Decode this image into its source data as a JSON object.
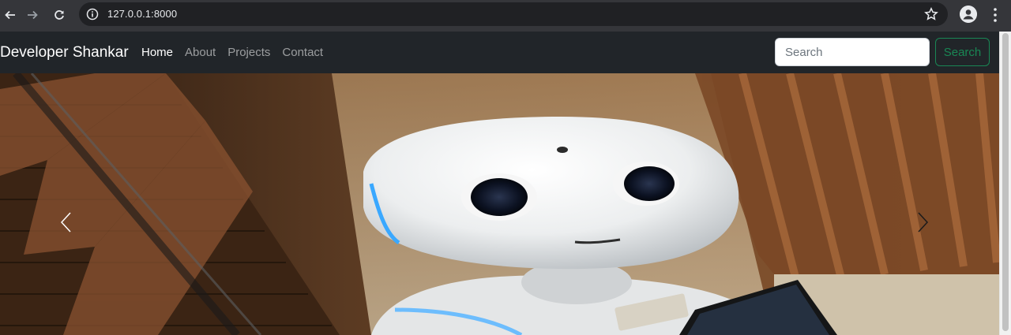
{
  "browser": {
    "url": "127.0.0.1:8000"
  },
  "navbar": {
    "brand": "Developer Shankar",
    "links": [
      {
        "label": "Home",
        "active": true
      },
      {
        "label": "About",
        "active": false
      },
      {
        "label": "Projects",
        "active": false
      },
      {
        "label": "Contact",
        "active": false
      }
    ],
    "search": {
      "placeholder": "Search",
      "value": "",
      "button_label": "Search"
    }
  },
  "carousel": {
    "image_subject": "robot",
    "controls": [
      "previous",
      "next"
    ]
  },
  "colors": {
    "navbar_bg": "#212529",
    "search_button": "#198754",
    "chrome_bg": "#35363a"
  }
}
